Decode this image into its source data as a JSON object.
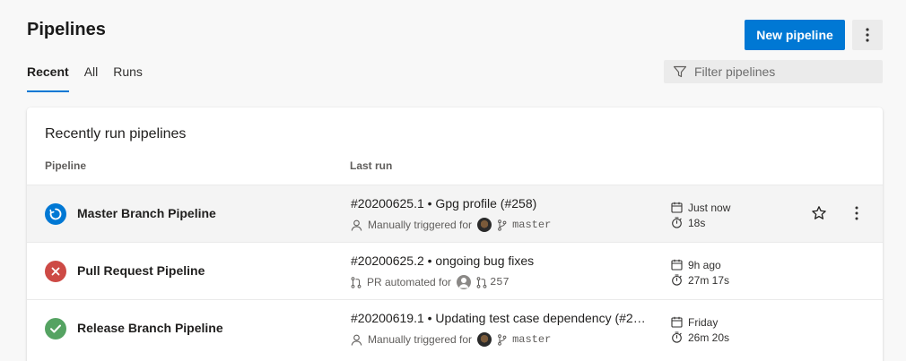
{
  "header": {
    "title": "Pipelines",
    "new_pipeline_label": "New pipeline"
  },
  "tabs": [
    {
      "label": "Recent",
      "active": true
    },
    {
      "label": "All",
      "active": false
    },
    {
      "label": "Runs",
      "active": false
    }
  ],
  "filter": {
    "placeholder": "Filter pipelines"
  },
  "card": {
    "title": "Recently run pipelines",
    "columns": {
      "pipeline": "Pipeline",
      "last_run": "Last run"
    }
  },
  "colors": {
    "accent": "#0078d4",
    "running": "#0078d4",
    "failed": "#cd4a45",
    "succeeded": "#55a362"
  },
  "rows": [
    {
      "status": "running",
      "status_icon": "running-icon",
      "name": "Master Branch Pipeline",
      "run_title": "#20200625.1 • Gpg profile (#258)",
      "trigger_icon": "person-icon",
      "trigger_text": "Manually triggered for",
      "ref_icon": "branch-icon",
      "ref": "master",
      "when": "Just now",
      "duration": "18s"
    },
    {
      "status": "failed",
      "status_icon": "failed-icon",
      "name": "Pull Request Pipeline",
      "run_title": "#20200625.2 • ongoing bug fixes",
      "trigger_icon": "pull-request-icon",
      "trigger_text": "PR automated for",
      "ref_icon": "pull-request-icon",
      "ref": "257",
      "when": "9h ago",
      "duration": "27m 17s"
    },
    {
      "status": "succeeded",
      "status_icon": "succeeded-icon",
      "name": "Release Branch Pipeline",
      "run_title": "#20200619.1 • Updating test case dependency (#2…",
      "trigger_icon": "person-icon",
      "trigger_text": "Manually triggered for",
      "ref_icon": "branch-icon",
      "ref": "master",
      "when": "Friday",
      "duration": "26m 20s"
    }
  ]
}
